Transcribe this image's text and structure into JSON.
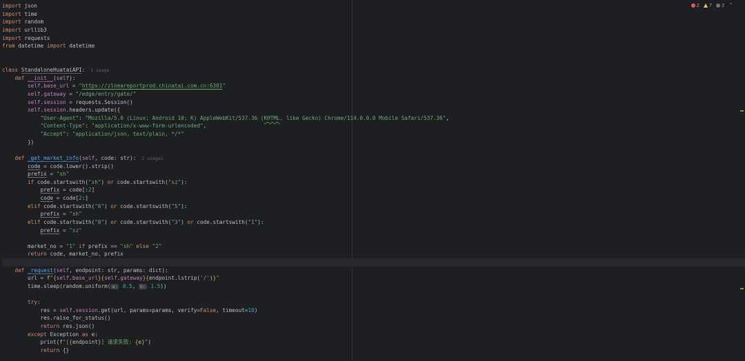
{
  "editor": {
    "bg": "#1e1f22",
    "caret_line_index": 32,
    "accent_colors": {
      "keyword": "#cf8e6d",
      "string": "#6aab73",
      "number": "#2aacb8",
      "self": "#c77dbb",
      "function_declaration": "#56a8f5"
    }
  },
  "inspections": {
    "errors": "2",
    "warnings": "7",
    "typos": "2",
    "chevron": "⌃"
  },
  "code": {
    "language": "python",
    "lines": [
      [
        [
          "k",
          "import"
        ],
        [
          "t",
          " json"
        ]
      ],
      [
        [
          "k",
          "import"
        ],
        [
          "t",
          " time"
        ]
      ],
      [
        [
          "k",
          "import"
        ],
        [
          "t",
          " random"
        ]
      ],
      [
        [
          "k",
          "import"
        ],
        [
          "t",
          " urllib3"
        ]
      ],
      [
        [
          "k",
          "import"
        ],
        [
          "t",
          " requests"
        ]
      ],
      [
        [
          "k",
          "from"
        ],
        [
          "t",
          " datetime "
        ],
        [
          "k",
          "import"
        ],
        [
          "t",
          " datetime"
        ]
      ],
      [],
      [],
      [
        [
          "k",
          "class "
        ],
        [
          "cd",
          "StandaloneHuataiAPI"
        ],
        [
          "t",
          ":"
        ],
        [
          "cv",
          "  1 usage"
        ]
      ],
      [
        [
          "t",
          "    "
        ],
        [
          "k",
          "def "
        ],
        [
          "m",
          "__init__"
        ],
        [
          "t",
          "("
        ],
        [
          "se",
          "self"
        ],
        [
          "t",
          "):"
        ]
      ],
      [
        [
          "t",
          "        "
        ],
        [
          "se",
          "self"
        ],
        [
          "t",
          "."
        ],
        [
          "f",
          "base_url"
        ],
        [
          "t",
          " = "
        ],
        [
          "s",
          "\""
        ],
        [
          "l",
          "https://zlneareportprod.chinatai.com.cn:6301"
        ],
        [
          "s",
          "\""
        ]
      ],
      [
        [
          "t",
          "        "
        ],
        [
          "se",
          "self"
        ],
        [
          "t",
          "."
        ],
        [
          "f",
          "gateway"
        ],
        [
          "t",
          " = "
        ],
        [
          "s",
          "\"/edge/entry/gate/\""
        ]
      ],
      [
        [
          "t",
          "        "
        ],
        [
          "se",
          "self"
        ],
        [
          "t",
          "."
        ],
        [
          "f",
          "session"
        ],
        [
          "t",
          " = requests.Session()"
        ]
      ],
      [
        [
          "t",
          "        "
        ],
        [
          "se",
          "self"
        ],
        [
          "t",
          "."
        ],
        [
          "f",
          "session"
        ],
        [
          "t",
          ".headers.update({"
        ]
      ],
      [
        [
          "t",
          "            "
        ],
        [
          "s",
          "\"User-Agent\""
        ],
        [
          "t",
          ": "
        ],
        [
          "s",
          "\"Mozilla/5.0 (Linux; Android 10; K) AppleWebKit/537.36 ("
        ],
        [
          "ty",
          "KHTML"
        ],
        [
          "s",
          ", like Gecko) Chrome/114.0.0.0 Mobile Safari/537.36\""
        ],
        [
          "t",
          ","
        ]
      ],
      [
        [
          "t",
          "            "
        ],
        [
          "s",
          "\"Content-Type\""
        ],
        [
          "t",
          ": "
        ],
        [
          "s",
          "\"application/x-www-form-urlencoded\""
        ],
        [
          "t",
          ","
        ]
      ],
      [
        [
          "t",
          "            "
        ],
        [
          "s",
          "\"Accept\""
        ],
        [
          "t",
          ": "
        ],
        [
          "s",
          "\"application/json, text/plain, */*\""
        ]
      ],
      [
        [
          "t",
          "        })"
        ]
      ],
      [],
      [
        [
          "t",
          "    "
        ],
        [
          "k",
          "def "
        ],
        [
          "d",
          "_get_market_info"
        ],
        [
          "t",
          "("
        ],
        [
          "se",
          "self"
        ],
        [
          "t",
          ", code: str):"
        ],
        [
          "cv",
          "  2 usages"
        ]
      ],
      [
        [
          "t",
          "        "
        ],
        [
          "re",
          "code"
        ],
        [
          "t",
          " = code.lower().strip()"
        ]
      ],
      [
        [
          "t",
          "        "
        ],
        [
          "re",
          "prefix"
        ],
        [
          "t",
          " = "
        ],
        [
          "s",
          "\"sh\""
        ]
      ],
      [
        [
          "t",
          "        "
        ],
        [
          "k",
          "if"
        ],
        [
          "t",
          " code.startswith("
        ],
        [
          "s",
          "\"sh\""
        ],
        [
          "t",
          ") "
        ],
        [
          "k",
          "or"
        ],
        [
          "t",
          " code.startswith("
        ],
        [
          "s",
          "\"sz\""
        ],
        [
          "t",
          "):"
        ]
      ],
      [
        [
          "t",
          "            "
        ],
        [
          "re",
          "prefix"
        ],
        [
          "t",
          " = code[:"
        ],
        [
          "n",
          "2"
        ],
        [
          "t",
          "]"
        ]
      ],
      [
        [
          "t",
          "            "
        ],
        [
          "re",
          "code"
        ],
        [
          "t",
          " = code["
        ],
        [
          "n",
          "2"
        ],
        [
          "t",
          ":]"
        ]
      ],
      [
        [
          "t",
          "        "
        ],
        [
          "k",
          "elif"
        ],
        [
          "t",
          " code.startswith("
        ],
        [
          "s",
          "\"6\""
        ],
        [
          "t",
          ") "
        ],
        [
          "k",
          "or"
        ],
        [
          "t",
          " code.startswith("
        ],
        [
          "s",
          "\"5\""
        ],
        [
          "t",
          "):"
        ]
      ],
      [
        [
          "t",
          "            "
        ],
        [
          "re",
          "prefix"
        ],
        [
          "t",
          " = "
        ],
        [
          "s",
          "\"sh\""
        ]
      ],
      [
        [
          "t",
          "        "
        ],
        [
          "k",
          "elif"
        ],
        [
          "t",
          " code.startswith("
        ],
        [
          "s",
          "\"0\""
        ],
        [
          "t",
          ") "
        ],
        [
          "k",
          "or"
        ],
        [
          "t",
          " code.startswith("
        ],
        [
          "s",
          "\"3\""
        ],
        [
          "t",
          ") "
        ],
        [
          "k",
          "or"
        ],
        [
          "t",
          " code.startswith("
        ],
        [
          "s",
          "\"1\""
        ],
        [
          "t",
          "):"
        ]
      ],
      [
        [
          "t",
          "            "
        ],
        [
          "re",
          "prefix"
        ],
        [
          "t",
          " = "
        ],
        [
          "s",
          "\"sz\""
        ]
      ],
      [],
      [
        [
          "t",
          "        market_no = "
        ],
        [
          "s",
          "\"1\""
        ],
        [
          "k",
          " if "
        ],
        [
          "t",
          "prefix == "
        ],
        [
          "s",
          "\"sh\""
        ],
        [
          "k",
          " else "
        ],
        [
          "s",
          "\"2\""
        ]
      ],
      [
        [
          "t",
          "        "
        ],
        [
          "k",
          "return"
        ],
        [
          "t",
          " code, market_no, prefix"
        ]
      ],
      [],
      [
        [
          "t",
          "    "
        ],
        [
          "k",
          "def "
        ],
        [
          "d",
          "_request"
        ],
        [
          "t",
          "("
        ],
        [
          "se",
          "self"
        ],
        [
          "t",
          ", endpoint: str, params: dict):"
        ]
      ],
      [
        [
          "t",
          "        url = f"
        ],
        [
          "s",
          "\""
        ],
        [
          "b",
          "{"
        ],
        [
          "se",
          "self"
        ],
        [
          "t",
          "."
        ],
        [
          "f",
          "base_url"
        ],
        [
          "b",
          "}"
        ],
        [
          "b",
          "{"
        ],
        [
          "se",
          "self"
        ],
        [
          "t",
          "."
        ],
        [
          "f",
          "gateway"
        ],
        [
          "b",
          "}"
        ],
        [
          "b",
          "{"
        ],
        [
          "t",
          "endpoint.lstrip("
        ],
        [
          "s",
          "'/'"
        ],
        [
          "t",
          ")"
        ],
        [
          "b",
          "}"
        ],
        [
          "s",
          "\""
        ]
      ],
      [
        [
          "t",
          "        time.sleep(random.uniform("
        ],
        [
          "i",
          "a:"
        ],
        [
          "t",
          " "
        ],
        [
          "n",
          "0.5"
        ],
        [
          "t",
          ", "
        ],
        [
          "i",
          "b:"
        ],
        [
          "t",
          " "
        ],
        [
          "n",
          "1.5"
        ],
        [
          "t",
          "))"
        ]
      ],
      [],
      [
        [
          "t",
          "        "
        ],
        [
          "k",
          "try"
        ],
        [
          "t",
          ":"
        ]
      ],
      [
        [
          "t",
          "            res = "
        ],
        [
          "se",
          "self"
        ],
        [
          "t",
          "."
        ],
        [
          "f",
          "session"
        ],
        [
          "t",
          ".get(url, params=params, verify="
        ],
        [
          "k",
          "False"
        ],
        [
          "t",
          ", timeout="
        ],
        [
          "n",
          "10"
        ],
        [
          "t",
          ")"
        ]
      ],
      [
        [
          "t",
          "            res.raise_for_status()"
        ]
      ],
      [
        [
          "t",
          "            "
        ],
        [
          "k",
          "return"
        ],
        [
          "t",
          " res.json()"
        ]
      ],
      [
        [
          "t",
          "        "
        ],
        [
          "k",
          "except "
        ],
        [
          "t",
          "Exception "
        ],
        [
          "k",
          "as"
        ],
        [
          "t",
          " e:"
        ]
      ],
      [
        [
          "t",
          "            print(f"
        ],
        [
          "s",
          "\"["
        ],
        [
          "b",
          "{"
        ],
        [
          "t",
          "endpoint"
        ],
        [
          "b",
          "}"
        ],
        [
          "s",
          "] 请求失败: "
        ],
        [
          "b",
          "{"
        ],
        [
          "t",
          "e"
        ],
        [
          "b",
          "}"
        ],
        [
          "s",
          "\""
        ],
        [
          "t",
          ")"
        ]
      ],
      [
        [
          "t",
          "            "
        ],
        [
          "k",
          "return"
        ],
        [
          "t",
          " {}"
        ]
      ]
    ]
  }
}
